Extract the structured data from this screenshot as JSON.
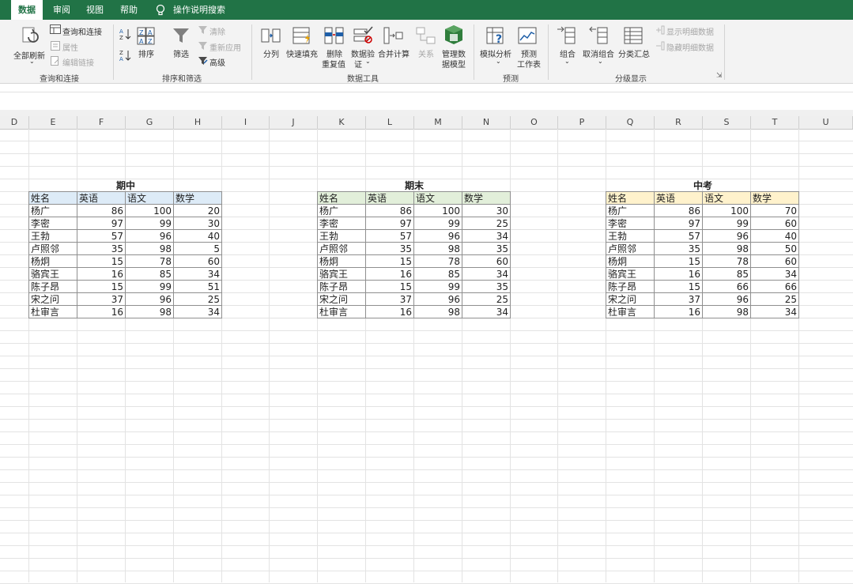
{
  "tabs": [
    {
      "label": "数据",
      "active": true
    },
    {
      "label": "审阅",
      "active": false
    },
    {
      "label": "视图",
      "active": false
    },
    {
      "label": "帮助",
      "active": false
    },
    {
      "label": "操作说明搜索",
      "active": false
    }
  ],
  "ribbon": {
    "refresh_all": "全部刷新",
    "query_conn": "查询和连接",
    "properties": "属性",
    "edit_links": "编辑链接",
    "group_query": "查询和连接",
    "sort": "排序",
    "filter": "筛选",
    "clear": "清除",
    "reapply": "重新应用",
    "advanced": "高级",
    "group_sort": "排序和筛选",
    "text_to_cols": "分列",
    "flash_fill": "快速填充",
    "remove_dup_1": "删除",
    "remove_dup_2": "重复值",
    "validation_1": "数据验",
    "validation_2": "证",
    "consolidate": "合并计算",
    "relations": "关系",
    "data_model_1": "管理数",
    "data_model_2": "据模型",
    "group_tools": "数据工具",
    "whatif": "模拟分析",
    "forecast_1": "预测",
    "forecast_2": "工作表",
    "group_forecast": "预测",
    "group_btn": "组合",
    "ungroup": "取消组合",
    "subtotal": "分类汇总",
    "show_detail": "显示明细数据",
    "hide_detail": "隐藏明细数据",
    "group_outline": "分级显示"
  },
  "columns": [
    "D",
    "E",
    "F",
    "G",
    "H",
    "I",
    "J",
    "K",
    "L",
    "M",
    "N",
    "O",
    "P",
    "Q",
    "R",
    "S",
    "T",
    "U"
  ],
  "headers": [
    "姓名",
    "英语",
    "语文",
    "数学"
  ],
  "tables": [
    {
      "title": "期中",
      "header_color": "#ddebf7",
      "rows": [
        [
          "杨广",
          "86",
          "100",
          "20"
        ],
        [
          "李密",
          "97",
          "99",
          "30"
        ],
        [
          "王勃",
          "57",
          "96",
          "40"
        ],
        [
          "卢照邻",
          "35",
          "98",
          "5"
        ],
        [
          "杨炯",
          "15",
          "78",
          "60"
        ],
        [
          "骆宾王",
          "16",
          "85",
          "34"
        ],
        [
          "陈子昂",
          "15",
          "99",
          "51"
        ],
        [
          "宋之问",
          "37",
          "96",
          "25"
        ],
        [
          "杜审言",
          "16",
          "98",
          "34"
        ]
      ]
    },
    {
      "title": "期末",
      "header_color": "#e2efda",
      "rows": [
        [
          "杨广",
          "86",
          "100",
          "30"
        ],
        [
          "李密",
          "97",
          "99",
          "25"
        ],
        [
          "王勃",
          "57",
          "96",
          "34"
        ],
        [
          "卢照邻",
          "35",
          "98",
          "35"
        ],
        [
          "杨炯",
          "15",
          "78",
          "60"
        ],
        [
          "骆宾王",
          "16",
          "85",
          "34"
        ],
        [
          "陈子昂",
          "15",
          "99",
          "35"
        ],
        [
          "宋之问",
          "37",
          "96",
          "25"
        ],
        [
          "杜审言",
          "16",
          "98",
          "34"
        ]
      ]
    },
    {
      "title": "中考",
      "header_color": "#fff2cc",
      "rows": [
        [
          "杨广",
          "86",
          "100",
          "70"
        ],
        [
          "李密",
          "97",
          "99",
          "60"
        ],
        [
          "王勃",
          "57",
          "96",
          "40"
        ],
        [
          "卢照邻",
          "35",
          "98",
          "50"
        ],
        [
          "杨炯",
          "15",
          "78",
          "60"
        ],
        [
          "骆宾王",
          "16",
          "85",
          "34"
        ],
        [
          "陈子昂",
          "15",
          "66",
          "66"
        ],
        [
          "宋之问",
          "37",
          "96",
          "25"
        ],
        [
          "杜审言",
          "16",
          "98",
          "34"
        ]
      ]
    }
  ],
  "colors": {
    "accent": "#217346"
  }
}
